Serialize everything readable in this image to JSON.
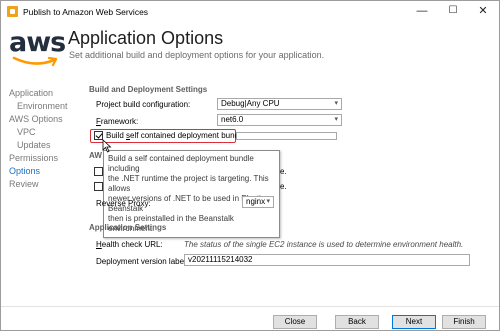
{
  "window": {
    "title": "Publish to Amazon Web Services",
    "minimize_glyph": "—",
    "maximize_glyph": "☐",
    "close_glyph": "✕"
  },
  "header": {
    "logo_text": "aws",
    "title": "Application Options",
    "subtitle": "Set additional build and deployment options for your application."
  },
  "sidebar": {
    "items": [
      {
        "label": "Application",
        "sub": false,
        "active": false
      },
      {
        "label": "Environment",
        "sub": true,
        "active": false
      },
      {
        "label": "AWS Options",
        "sub": false,
        "active": false
      },
      {
        "label": "VPC",
        "sub": true,
        "active": false
      },
      {
        "label": "Updates",
        "sub": true,
        "active": false
      },
      {
        "label": "Permissions",
        "sub": false,
        "active": false
      },
      {
        "label": "Options",
        "sub": false,
        "active": true
      },
      {
        "label": "Review",
        "sub": false,
        "active": false
      }
    ]
  },
  "build": {
    "section_header": "Build and Deployment Settings",
    "project_config_label": "Project build configuration:",
    "project_config_value": "Debug|Any CPU",
    "framework_label_underlined": "F",
    "framework_label_rest": "ramework:",
    "framework_value": "net6.0",
    "self_contained_checked": true,
    "self_contained_label_pre": "Build ",
    "self_contained_label_u": "s",
    "self_contained_label_post": "elf contained deployment bundle",
    "partial_section_header": "AW",
    "tooltip_lines": [
      "Build a self contained deployment bundle including",
      "the .NET runtime the project is targeting. This allows",
      "newer versions of .NET to be used in Elastic Beanstalk",
      "then is preinstalled in the Beanstalk environment."
    ],
    "partial_right_1": "e.",
    "partial_right_2": "e.",
    "reverse_proxy_label": "Reverse Proxy:",
    "reverse_proxy_value": "nginx"
  },
  "app_settings": {
    "section_header": "Application Settings",
    "health_label_u": "H",
    "health_label_rest": "ealth check URL:",
    "health_text": "The status of the single EC2 instance is used to determine environment health.",
    "deploy_version_label": "Deployment version label:",
    "deploy_version_value": "v20211115214032"
  },
  "footer": {
    "close_label": "Close",
    "back_label": "Back",
    "next_label": "Next",
    "finish_label": "Finish"
  },
  "colors": {
    "active_nav": "#1e6fc6",
    "highlight": "#d9303b",
    "aws_orange": "#ff9900",
    "aws_dark": "#232f3e"
  }
}
